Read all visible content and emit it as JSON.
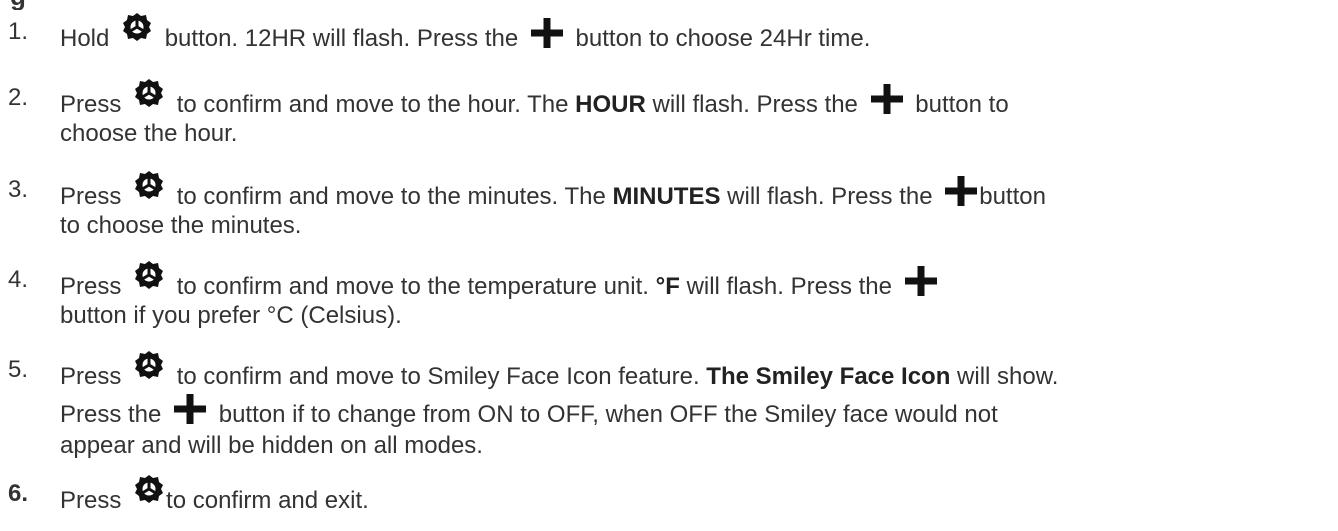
{
  "heading_fragment": "g",
  "steps": [
    {
      "number": "1.",
      "l1": {
        "a": "Hold",
        "b": "button. 12HR will flash. Press the",
        "c": "button to choose 24Hr time."
      }
    },
    {
      "number": "2.",
      "l1": {
        "a": "Press",
        "b": "to confirm and move to the hour. The",
        "bold": "HOUR",
        "c": "will flash.  Press the",
        "d": "button to"
      },
      "l2": "choose the hour."
    },
    {
      "number": "3.",
      "l1": {
        "a": "Press",
        "b": "to confirm and move to the minutes. The",
        "bold": "MINUTES",
        "c": "will flash. Press the",
        "d": "button"
      },
      "l2": "to choose the minutes."
    },
    {
      "number": "4.",
      "l1": {
        "a": "Press",
        "b": "to confirm and move to the temperature unit.",
        "bold": "°F",
        "c": "will flash. Press the"
      },
      "l2": "button if you prefer °C (Celsius)."
    },
    {
      "number": "5.",
      "l1": {
        "a": "Press",
        "b": "to confirm and move to Smiley Face Icon feature.",
        "bold": "The Smiley Face Icon",
        "c": "will show."
      },
      "l2": {
        "a": "Press the",
        "b": "button if to change from ON to OFF, when OFF the Smiley face would not"
      },
      "l3": "appear and will be hidden on all modes."
    },
    {
      "number": "6.",
      "l1": {
        "a": "Press",
        "b": "to confirm and exit."
      }
    }
  ],
  "icons": {
    "set": "gear-icon",
    "plus": "plus-icon"
  },
  "colors": {
    "text": "#333333",
    "icon": "#111111"
  }
}
